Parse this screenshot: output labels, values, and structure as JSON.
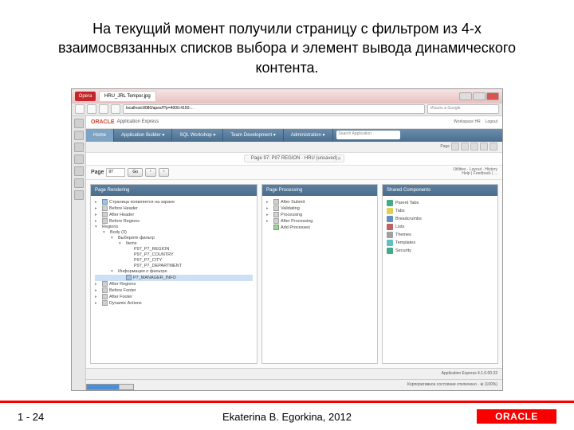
{
  "slide": {
    "title": "На текущий момент получили страницу с фильтром из 4-х взаимосвязанных списков выбора и элемент вывода динамического контента."
  },
  "window": {
    "opera_label": "Opera",
    "tab_title": "HRU_JRL Tempor.jpg"
  },
  "addr": {
    "url": "localhost:8080/apex/f?p=4000:4150:...",
    "search_placeholder": "Искать в Google"
  },
  "oracle_header": {
    "brand": "ORACLE",
    "product": "Application Express",
    "workspace": "Workspace HR",
    "user": "Logout"
  },
  "nav": {
    "tabs": [
      "Home",
      "Application Builder ▾",
      "SQL Workshop ▾",
      "Team Development ▾",
      "Administration ▾"
    ],
    "search_placeholder": "Search Application"
  },
  "subbar": {
    "page_label": "Page"
  },
  "breadcrumb": {
    "text": "Page 97: P97 REGION · HRU (unsaved)"
  },
  "page_row": {
    "label": "Page",
    "value": "97",
    "go": "Go",
    "side1": "Utilities · Layout · History",
    "side2": "Help | Feedback | ..."
  },
  "panels": {
    "rendering": {
      "title": "Page Rendering",
      "items": [
        {
          "lvl": 0,
          "tgl": "▸",
          "ico": "blue",
          "txt": "Страница появляется на экране"
        },
        {
          "lvl": 0,
          "tgl": "▸",
          "ico": "gray",
          "txt": "Before Header"
        },
        {
          "lvl": 0,
          "tgl": "▸",
          "ico": "gray",
          "txt": "After Header"
        },
        {
          "lvl": 0,
          "tgl": "▸",
          "ico": "gray",
          "txt": "Before Regions"
        },
        {
          "lvl": 0,
          "tgl": "▾",
          "ico": "",
          "txt": "Regions"
        },
        {
          "lvl": 1,
          "tgl": "▾",
          "ico": "",
          "txt": "Body (3)"
        },
        {
          "lvl": 2,
          "tgl": "▾",
          "ico": "",
          "txt": "Выберите фильтр"
        },
        {
          "lvl": 3,
          "tgl": "▾",
          "ico": "",
          "txt": "Items"
        },
        {
          "lvl": 4,
          "tgl": "",
          "ico": "",
          "txt": "P97_P7_REGION"
        },
        {
          "lvl": 4,
          "tgl": "",
          "ico": "",
          "txt": "P97_P7_COUNTRY"
        },
        {
          "lvl": 4,
          "tgl": "",
          "ico": "",
          "txt": "P97_P7_CITY"
        },
        {
          "lvl": 4,
          "tgl": "",
          "ico": "",
          "txt": "P97_P7_DEPARTMENT"
        },
        {
          "lvl": 2,
          "tgl": "▾",
          "ico": "",
          "txt": "Информация о фильтре"
        },
        {
          "lvl": 3,
          "tgl": "",
          "ico": "blue",
          "txt": "P7_MANAGER_INFO",
          "hl": true
        },
        {
          "lvl": 0,
          "tgl": "▸",
          "ico": "gray",
          "txt": "After Regions"
        },
        {
          "lvl": 0,
          "tgl": "▸",
          "ico": "gray",
          "txt": "Before Footer"
        },
        {
          "lvl": 0,
          "tgl": "▸",
          "ico": "gray",
          "txt": "After Footer"
        },
        {
          "lvl": 0,
          "tgl": "▸",
          "ico": "gray",
          "txt": "Dynamic Actions"
        }
      ]
    },
    "processing": {
      "title": "Page Processing",
      "items": [
        {
          "lvl": 0,
          "tgl": "▸",
          "ico": "gray",
          "txt": "After Submit"
        },
        {
          "lvl": 0,
          "tgl": "▸",
          "ico": "gray",
          "txt": "Validating"
        },
        {
          "lvl": 0,
          "tgl": "▸",
          "ico": "gray",
          "txt": "Processing"
        },
        {
          "lvl": 0,
          "tgl": "▸",
          "ico": "gray",
          "txt": "After Processing"
        },
        {
          "lvl": 0,
          "tgl": "",
          "ico": "green",
          "txt": "Add Processes"
        }
      ]
    },
    "shared": {
      "title": "Shared Components",
      "rows": [
        {
          "ico": "si1",
          "txt": "Parent Tabs"
        },
        {
          "ico": "si2",
          "txt": "Tabs"
        },
        {
          "ico": "si3",
          "txt": "Breadcrumbs"
        },
        {
          "ico": "si4",
          "txt": "Lists"
        },
        {
          "ico": "si5",
          "txt": "Themes"
        },
        {
          "ico": "si6",
          "txt": "Templates"
        },
        {
          "ico": "si1",
          "txt": "Security"
        }
      ]
    }
  },
  "status": {
    "left": "",
    "right": "Application Express 4.1.0.00.32",
    "bottom": "Корпоративное состояние отключено · ⊕ (100%)"
  },
  "footer": {
    "page": "1 - 24",
    "author": "Ekaterina B. Egorkina, 2012",
    "oracle": "ORACLE"
  }
}
